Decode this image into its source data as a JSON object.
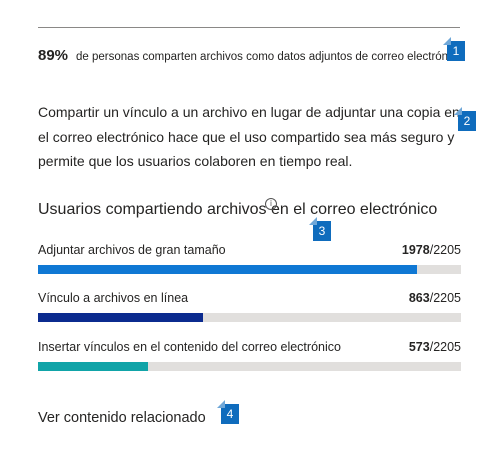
{
  "stat": {
    "number": "89%",
    "text": "de personas comparten archivos como datos adjuntos de correo electrónico"
  },
  "paragraph": "Compartir un vínculo a un archivo en lugar de adjuntar una copia en el correo electrónico hace que el uso compartido sea más seguro y permite que los usuarios colaboren en tiempo real.",
  "section": {
    "title": "Usuarios compartiendo archivos en el correo electrónico",
    "info_icon": "info-icon"
  },
  "bars": [
    {
      "label": "Adjuntar archivos de gran tamaño",
      "value": "1978",
      "total": "/2205",
      "color": "#0f78d4",
      "fraction": 0.897
    },
    {
      "label": "Vínculo a archivos en línea",
      "value": "863",
      "total": "/2205",
      "color": "#0b2b8f",
      "fraction": 0.391
    },
    {
      "label": "Insertar vínculos en el contenido del correo electrónico",
      "value": "573",
      "total": "/2205",
      "color": "#11a4a8",
      "fraction": 0.26
    }
  ],
  "related": "Ver contenido relacionado",
  "callouts": [
    "1",
    "2",
    "3",
    "4"
  ]
}
